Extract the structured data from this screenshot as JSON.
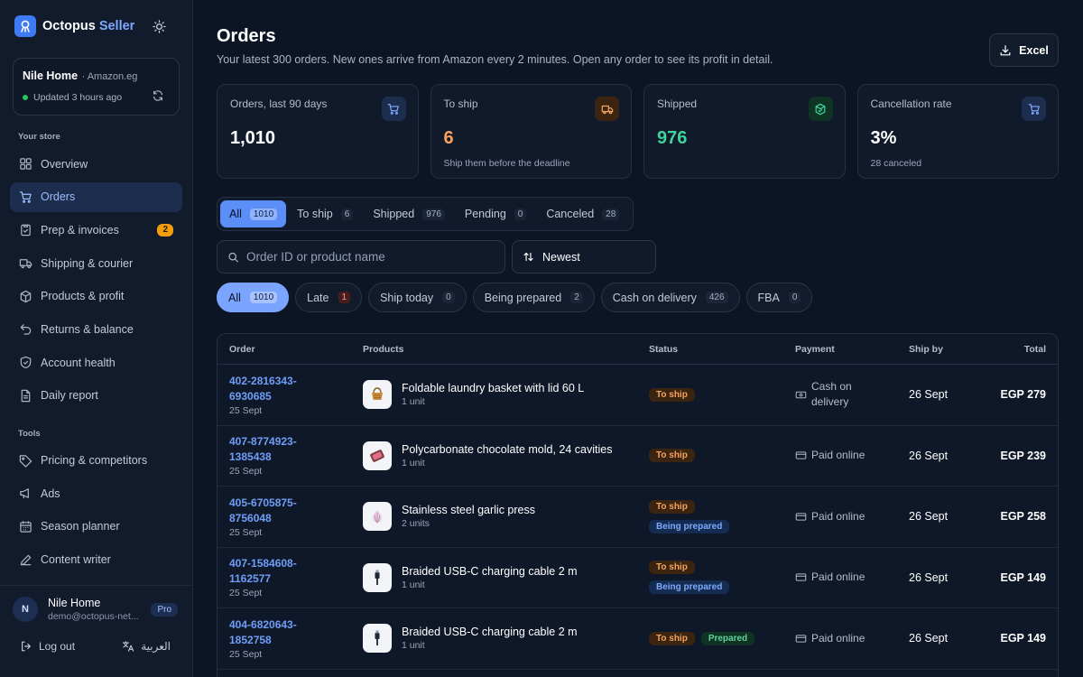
{
  "brand": {
    "name": "Octopus",
    "accent": "Seller"
  },
  "store": {
    "name": "Nile Home",
    "market": "· Amazon.eg",
    "updated": "Updated 3 hours ago"
  },
  "sidebar": {
    "section_store": "Your store",
    "items": [
      {
        "label": "Overview",
        "icon": "grid-icon"
      },
      {
        "label": "Orders",
        "icon": "cart-icon",
        "active": true
      },
      {
        "label": "Prep & invoices",
        "icon": "clipboard-icon",
        "badge": "2"
      },
      {
        "label": "Shipping & courier",
        "icon": "truck-icon"
      },
      {
        "label": "Products & profit",
        "icon": "box-icon"
      },
      {
        "label": "Returns & balance",
        "icon": "return-icon"
      },
      {
        "label": "Account health",
        "icon": "shield-icon"
      },
      {
        "label": "Daily report",
        "icon": "document-icon"
      }
    ],
    "section_tools": "Tools",
    "tools": [
      {
        "label": "Pricing & competitors",
        "icon": "tag-icon"
      },
      {
        "label": "Ads",
        "icon": "megaphone-icon"
      },
      {
        "label": "Season planner",
        "icon": "calendar-icon"
      },
      {
        "label": "Content writer",
        "icon": "pen-icon"
      }
    ]
  },
  "user": {
    "initial": "N",
    "name": "Nile Home",
    "email": "demo@octopus-net...",
    "plan": "Pro"
  },
  "footer": {
    "logout": "Log out",
    "language": "العربية"
  },
  "header": {
    "title": "Orders",
    "subtitle": "Your latest 300 orders. New ones arrive from Amazon every 2 minutes. Open any order to see its profit in detail.",
    "excel": "Excel"
  },
  "stats": [
    {
      "label": "Orders, last 90 days",
      "value": "1,010",
      "note": "",
      "color": "#ffffff",
      "icon_bg": "#1c2d4d",
      "icon_color": "#7ea9ff"
    },
    {
      "label": "To ship",
      "value": "6",
      "note": "Ship them before the deadline",
      "color": "#f5a35c",
      "icon_bg": "#3b2410",
      "icon_color": "#f5a35c"
    },
    {
      "label": "Shipped",
      "value": "976",
      "note": "",
      "color": "#3fd39a",
      "icon_bg": "#0f3324",
      "icon_color": "#3fd39a"
    },
    {
      "label": "Cancellation rate",
      "value": "3%",
      "note": "28 canceled",
      "color": "#ffffff",
      "icon_bg": "#1c2d4d",
      "icon_color": "#7ea9ff"
    }
  ],
  "tabs": [
    {
      "label": "All",
      "count": "1010",
      "active": true
    },
    {
      "label": "To ship",
      "count": "6"
    },
    {
      "label": "Shipped",
      "count": "976"
    },
    {
      "label": "Pending",
      "count": "0"
    },
    {
      "label": "Canceled",
      "count": "28"
    }
  ],
  "search": {
    "placeholder": "Order ID or product name"
  },
  "sort": {
    "label": "Newest"
  },
  "chips": [
    {
      "label": "All",
      "count": "1010",
      "active": true
    },
    {
      "label": "Late",
      "count": "1",
      "late": true
    },
    {
      "label": "Ship today",
      "count": "0"
    },
    {
      "label": "Being prepared",
      "count": "2"
    },
    {
      "label": "Cash on delivery",
      "count": "426"
    },
    {
      "label": "FBA",
      "count": "0"
    }
  ],
  "table": {
    "columns": {
      "order": "Order",
      "products": "Products",
      "status": "Status",
      "payment": "Payment",
      "ship_by": "Ship by",
      "total": "Total"
    },
    "rows": [
      {
        "order_a": "402-2816343-",
        "order_b": "6930685",
        "date": "25 Sept",
        "product": "Foldable laundry basket with lid 60 L",
        "qty": "1 unit",
        "thumb": "basket-icon",
        "statuses": [
          "To ship"
        ],
        "layout": "stack",
        "payment": "Cash on delivery",
        "pay_icon": "cash-icon",
        "ship_by": "26 Sept",
        "total": "EGP 279"
      },
      {
        "order_a": "407-8774923-",
        "order_b": "1385438",
        "date": "25 Sept",
        "product": "Polycarbonate chocolate mold, 24 cavities",
        "qty": "1 unit",
        "thumb": "mold-icon",
        "statuses": [
          "To ship"
        ],
        "layout": "stack",
        "payment": "Paid online",
        "pay_icon": "card-icon",
        "ship_by": "26 Sept",
        "total": "EGP 239"
      },
      {
        "order_a": "405-6705875-",
        "order_b": "8756048",
        "date": "25 Sept",
        "product": "Stainless steel garlic press",
        "qty": "2 units",
        "thumb": "garlic-icon",
        "statuses": [
          "To ship",
          "Being prepared"
        ],
        "layout": "stack",
        "payment": "Paid online",
        "pay_icon": "card-icon",
        "ship_by": "26 Sept",
        "total": "EGP 258"
      },
      {
        "order_a": "407-1584608-",
        "order_b": "1162577",
        "date": "25 Sept",
        "product": "Braided USB-C charging cable 2 m",
        "qty": "1 unit",
        "thumb": "cable-icon",
        "statuses": [
          "To ship",
          "Being prepared"
        ],
        "layout": "stack",
        "payment": "Paid online",
        "pay_icon": "card-icon",
        "ship_by": "26 Sept",
        "total": "EGP 149"
      },
      {
        "order_a": "404-6820643-",
        "order_b": "1852758",
        "date": "25 Sept",
        "product": "Braided USB-C charging cable 2 m",
        "qty": "1 unit",
        "thumb": "cable-icon",
        "statuses": [
          "To ship",
          "Prepared"
        ],
        "layout": "inline",
        "payment": "Paid online",
        "pay_icon": "card-icon",
        "ship_by": "26 Sept",
        "total": "EGP 149"
      }
    ]
  }
}
